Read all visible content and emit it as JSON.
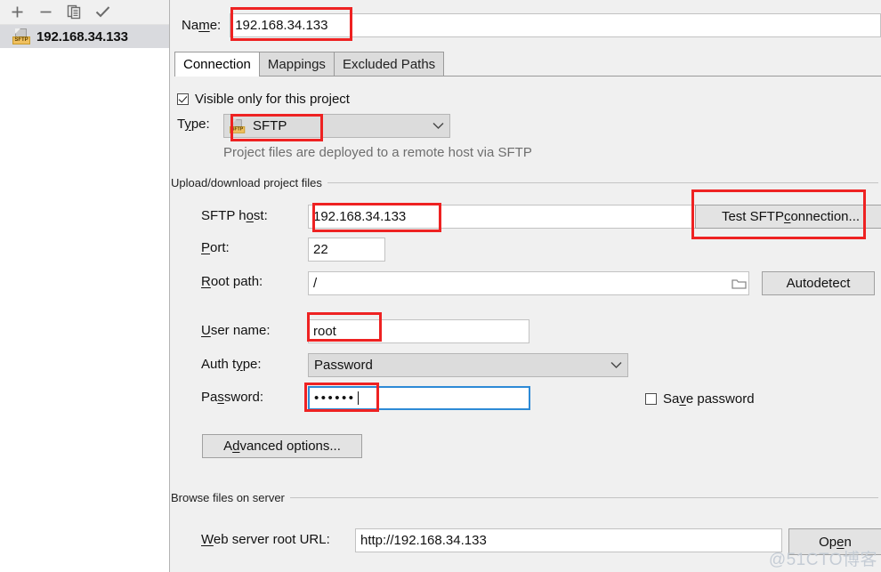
{
  "sidebar": {
    "toolbar": [
      {
        "name": "add-icon",
        "label": "+"
      },
      {
        "name": "remove-icon",
        "label": "−"
      },
      {
        "name": "copy-icon",
        "label": "copy"
      },
      {
        "name": "check-icon",
        "label": "✓"
      }
    ],
    "items": [
      {
        "label": "192.168.34.133",
        "icon": "sftp-server-icon",
        "icon_tag": "SFTP",
        "selected": true
      }
    ]
  },
  "name_row": {
    "label_pre": "Na",
    "label_accel": "m",
    "label_post": "e:",
    "value": "192.168.34.133"
  },
  "tabs": [
    {
      "label": "Connection",
      "active": true
    },
    {
      "label": "Mappings",
      "active": false
    },
    {
      "label": "Excluded Paths",
      "active": false
    }
  ],
  "connection": {
    "visible_only_checkbox": {
      "label": "Visible only for this project",
      "checked": true
    },
    "type_row": {
      "label_pre": "T",
      "label_accel": "y",
      "label_post": "pe:",
      "value": "SFTP",
      "icon_tag": "SFTP"
    },
    "type_hint": "Project files are deployed to a remote host via SFTP",
    "upload_group_title": "Upload/download project files",
    "host_row": {
      "label_pre": "SFTP h",
      "label_accel": "o",
      "label_post": "st:",
      "value": "192.168.34.133"
    },
    "test_button": {
      "label_pre": "Test SFTP ",
      "label_accel": "c",
      "label_post": "onnection..."
    },
    "port_row": {
      "label_pre": "",
      "label_accel": "P",
      "label_post": "ort:",
      "value": "22"
    },
    "root_path_row": {
      "label_pre": "",
      "label_accel": "R",
      "label_post": "oot path:",
      "value": "/",
      "browse_icon": "folder-icon"
    },
    "autodetect_button": {
      "label": "Autodetect"
    },
    "user_row": {
      "label_pre": "",
      "label_accel": "U",
      "label_post": "ser name:",
      "value": "root"
    },
    "auth_row": {
      "label_pre": "Auth t",
      "label_accel": "y",
      "label_post": "pe:",
      "value": "Password"
    },
    "password_row": {
      "label_pre": "Pa",
      "label_accel": "s",
      "label_post": "sword:",
      "value": "••••••"
    },
    "save_password_checkbox": {
      "label_pre": "Sa",
      "label_accel": "v",
      "label_post": "e password",
      "checked": false
    },
    "advanced_button": {
      "label_pre": "A",
      "label_accel": "d",
      "label_post": "vanced options..."
    },
    "browse_group_title": "Browse files on server",
    "web_url_row": {
      "label_pre": "",
      "label_accel": "W",
      "label_post": "eb server root URL:",
      "value": "http://192.168.34.133"
    },
    "open_button": {
      "label_pre": "Op",
      "label_accel": "e",
      "label_post": "n"
    }
  },
  "watermark": "@51CTO博客",
  "colors": {
    "highlight_red": "#ee2222",
    "selection_bg": "#d9dade",
    "focus_blue": "#2d8ad6",
    "panel_bg": "#f0f0f0"
  }
}
